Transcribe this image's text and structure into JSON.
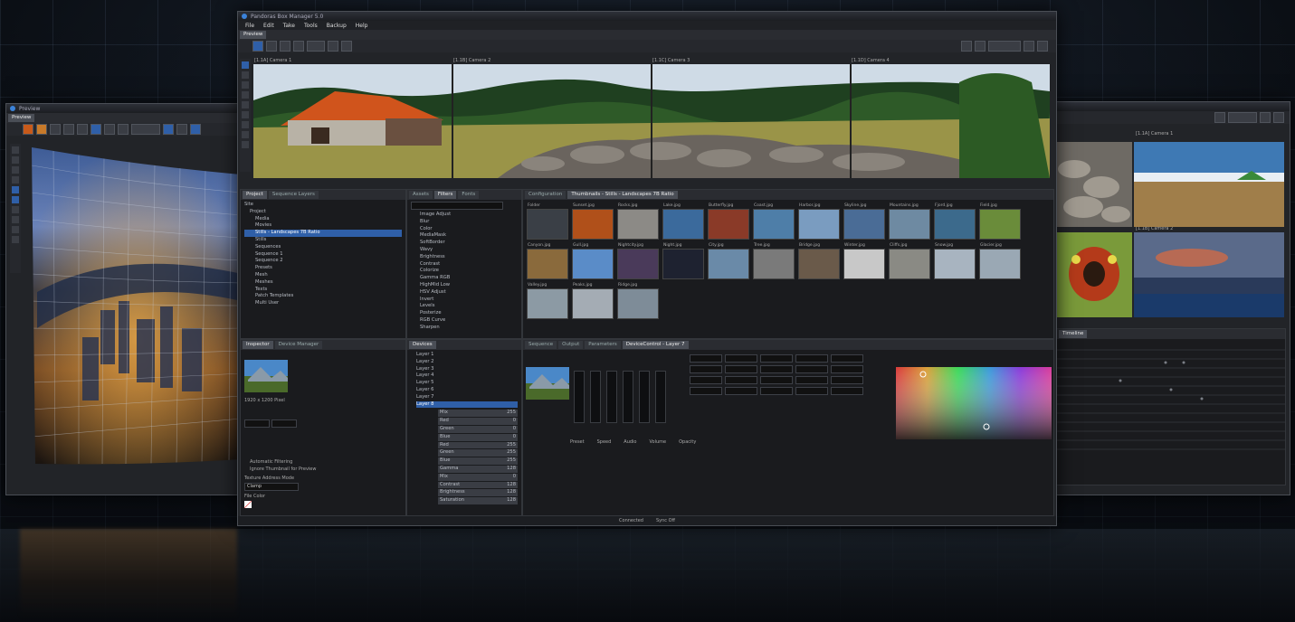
{
  "main_window": {
    "title": "Pandoras Box Manager 5.0",
    "menu": [
      "File",
      "Edit",
      "Take",
      "Tools",
      "Backup",
      "Help"
    ],
    "preview_tab": "Preview",
    "camera_labels": [
      "[1.1A] Camera 1",
      "[1.1B] Camera 2",
      "[1.1C] Camera 3",
      "[1.1D] Camera 4"
    ],
    "project_tabs": [
      "Project",
      "Sequence Layers"
    ],
    "project_tree": [
      "Site",
      "Project",
      "Media",
      "Movies",
      "Stills - Landscapes 7B Ratio",
      "Stills",
      "Sequences",
      "Sequence 1",
      "Sequence 2",
      "Presets",
      "Mesh",
      "Meshes",
      "Texts",
      "Patch Templates",
      "Multi User"
    ],
    "asset_tree": [
      "Image Adjust",
      "Blur",
      "Color",
      "MediaMask",
      "SoftBorder",
      "Wavy",
      "Brightness",
      "Contrast",
      "Colorize",
      "Gamma RGB",
      "HighMid Low",
      "HSV Adjust",
      "Invert",
      "Levels",
      "Posterize",
      "RGB Curve",
      "Sharpen"
    ],
    "asset_tabs": [
      "Assets",
      "Filters",
      "Fonts"
    ],
    "content_tabs": [
      "Configuration",
      "Thumbnails - Stills - Landscapes 7B Ratio"
    ],
    "thumbnails": [
      {
        "name": "Folder",
        "color": "#3a3f46"
      },
      {
        "name": "Sunset.jpg",
        "color": "#b0501a"
      },
      {
        "name": "Rocks.jpg",
        "color": "#8c8a86"
      },
      {
        "name": "Lake.jpg",
        "color": "#3b6a9c"
      },
      {
        "name": "Butterfly.jpg",
        "color": "#8a3a28"
      },
      {
        "name": "Coast.jpg",
        "color": "#4e7ea8"
      },
      {
        "name": "Harbor.jpg",
        "color": "#7a9cc0"
      },
      {
        "name": "Skyline.jpg",
        "color": "#4a6c96"
      },
      {
        "name": "Mountains.jpg",
        "color": "#6e8aa2"
      },
      {
        "name": "Fjord.jpg",
        "color": "#3c6a8c"
      },
      {
        "name": "Field.jpg",
        "color": "#6a8c3a"
      },
      {
        "name": "Canyon.jpg",
        "color": "#8a6a3c"
      },
      {
        "name": "Gull.jpg",
        "color": "#5a8cc8"
      },
      {
        "name": "Nightcity.jpg",
        "color": "#4a3a5a"
      },
      {
        "name": "Night.jpg",
        "color": "#1e2230"
      },
      {
        "name": "City.jpg",
        "color": "#6a8aa8"
      },
      {
        "name": "Tree.jpg",
        "color": "#7a7a7a"
      },
      {
        "name": "Bridge.jpg",
        "color": "#6a5a4a"
      },
      {
        "name": "Winter.jpg",
        "color": "#c8c8c8"
      },
      {
        "name": "Cliffs.jpg",
        "color": "#8a8a84"
      },
      {
        "name": "Snow.jpg",
        "color": "#a8b4c0"
      },
      {
        "name": "Glacier.jpg",
        "color": "#9aa8b4"
      },
      {
        "name": "Valley.jpg",
        "color": "#8c9aa4"
      },
      {
        "name": "Peaks.jpg",
        "color": "#a4acb4"
      },
      {
        "name": "Ridge.jpg",
        "color": "#7e8c98"
      }
    ],
    "inspector_tabs": [
      "Inspector",
      "Device Manager"
    ],
    "inspector": {
      "resolution": "1920 x 1200 Pixel",
      "options": [
        "Automatic Filtering",
        "Ignore Thumbnail for Preview"
      ],
      "blend_label": "Texture Address Mode",
      "blend_value": "Clamp",
      "file_color": "File Color"
    },
    "devices_tab": "Devices",
    "devices": [
      "Layer 1",
      "Layer 2",
      "Layer 3",
      "Layer 4",
      "Layer 5",
      "Layer 6",
      "Layer 7",
      "Layer 8"
    ],
    "device_params": [
      {
        "name": "Mix",
        "value": "255"
      },
      {
        "name": "Red",
        "value": "0"
      },
      {
        "name": "Green",
        "value": "0"
      },
      {
        "name": "Blue",
        "value": "0"
      },
      {
        "name": "Red",
        "value": "255"
      },
      {
        "name": "Green",
        "value": "255"
      },
      {
        "name": "Blue",
        "value": "255"
      },
      {
        "name": "Gamma",
        "value": "128"
      },
      {
        "name": "Mix",
        "value": "0"
      },
      {
        "name": "Contrast",
        "value": "128"
      },
      {
        "name": "Brightness",
        "value": "128"
      },
      {
        "name": "Saturation",
        "value": "128"
      }
    ],
    "layer_tabs": [
      "Sequence",
      "Output",
      "Parameters",
      "DeviceControl - Layer 7"
    ],
    "fader_labels": [
      "Preset",
      "Speed",
      "Audio",
      "Volume",
      "Opacity"
    ],
    "status": [
      "Connected",
      "Sync Off"
    ]
  },
  "left_window": {
    "title": "Preview",
    "tab": "Preview"
  },
  "right_window": {
    "camera_labels": [
      "[1.1A] Camera 1",
      "[1.1B] Camera 2"
    ],
    "timeline_label": "Timeline"
  }
}
